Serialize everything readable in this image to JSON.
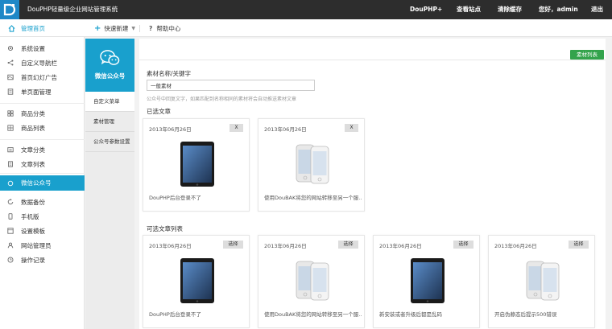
{
  "app": {
    "title": "DouPHP轻量级企业网站管理系统"
  },
  "topnav": {
    "douphp": "DouPHP+",
    "view_site": "查看站点",
    "clear_cache": "清除缓存",
    "greeting": "您好，admin",
    "logout": "退出"
  },
  "subbar": {
    "home": "管理首页",
    "quick_new": "快速新建",
    "help": "帮助中心"
  },
  "sidebar": {
    "items": [
      {
        "label": "系统设置",
        "icon": "gear-icon"
      },
      {
        "label": "自定义导航栏",
        "icon": "share-icon"
      },
      {
        "label": "首页幻灯广告",
        "icon": "slides-icon"
      },
      {
        "label": "单页面管理",
        "icon": "page-icon"
      },
      {
        "label": "商品分类",
        "icon": "grid-icon"
      },
      {
        "label": "商品列表",
        "icon": "list-icon"
      },
      {
        "label": "文章分类",
        "icon": "folder-icon"
      },
      {
        "label": "文章列表",
        "icon": "article-icon"
      },
      {
        "label": "微信公众号",
        "icon": "wechat-icon"
      },
      {
        "label": "数据备份",
        "icon": "backup-icon"
      },
      {
        "label": "手机版",
        "icon": "mobile-icon"
      },
      {
        "label": "设置模板",
        "icon": "template-icon"
      },
      {
        "label": "网站管理员",
        "icon": "user-icon"
      },
      {
        "label": "操作记录",
        "icon": "clock-icon"
      }
    ],
    "active_index": 8
  },
  "wechat_panel": {
    "title": "微信公众号",
    "items": [
      "自定义菜单",
      "素材管理",
      "公众号参数设置"
    ]
  },
  "main": {
    "material_list_button": "素材列表",
    "field_label": "素材名称/关键字",
    "field_value": "一般素材",
    "field_hint": "公众号中回复文字，如果匹配到名称相同的素材将会自动推送素材文章",
    "selected_title": "已选文章",
    "available_title": "可选文章列表",
    "remove_label": "X",
    "select_label": "选择",
    "selected": [
      {
        "date": "2013年06月26日",
        "caption": "DouPHP后台登录不了",
        "device": "ipad"
      },
      {
        "date": "2013年06月26日",
        "caption": "使用DouBAK将您的网站转移至另一个服...",
        "device": "iphone"
      }
    ],
    "available": [
      {
        "date": "2013年06月26日",
        "caption": "DouPHP后台登录不了",
        "device": "ipad"
      },
      {
        "date": "2013年06月26日",
        "caption": "使用DouBAK将您的网站转移至另一个服...",
        "device": "iphone"
      },
      {
        "date": "2013年06月26日",
        "caption": "新安装或者升级后都是乱码",
        "device": "ipad"
      },
      {
        "date": "2013年06月26日",
        "caption": "开启伪静态后提示500错误",
        "device": "iphone"
      }
    ]
  },
  "colors": {
    "accent": "#19a0cd",
    "topbar": "#2d2d2d",
    "green": "#33a34c"
  }
}
